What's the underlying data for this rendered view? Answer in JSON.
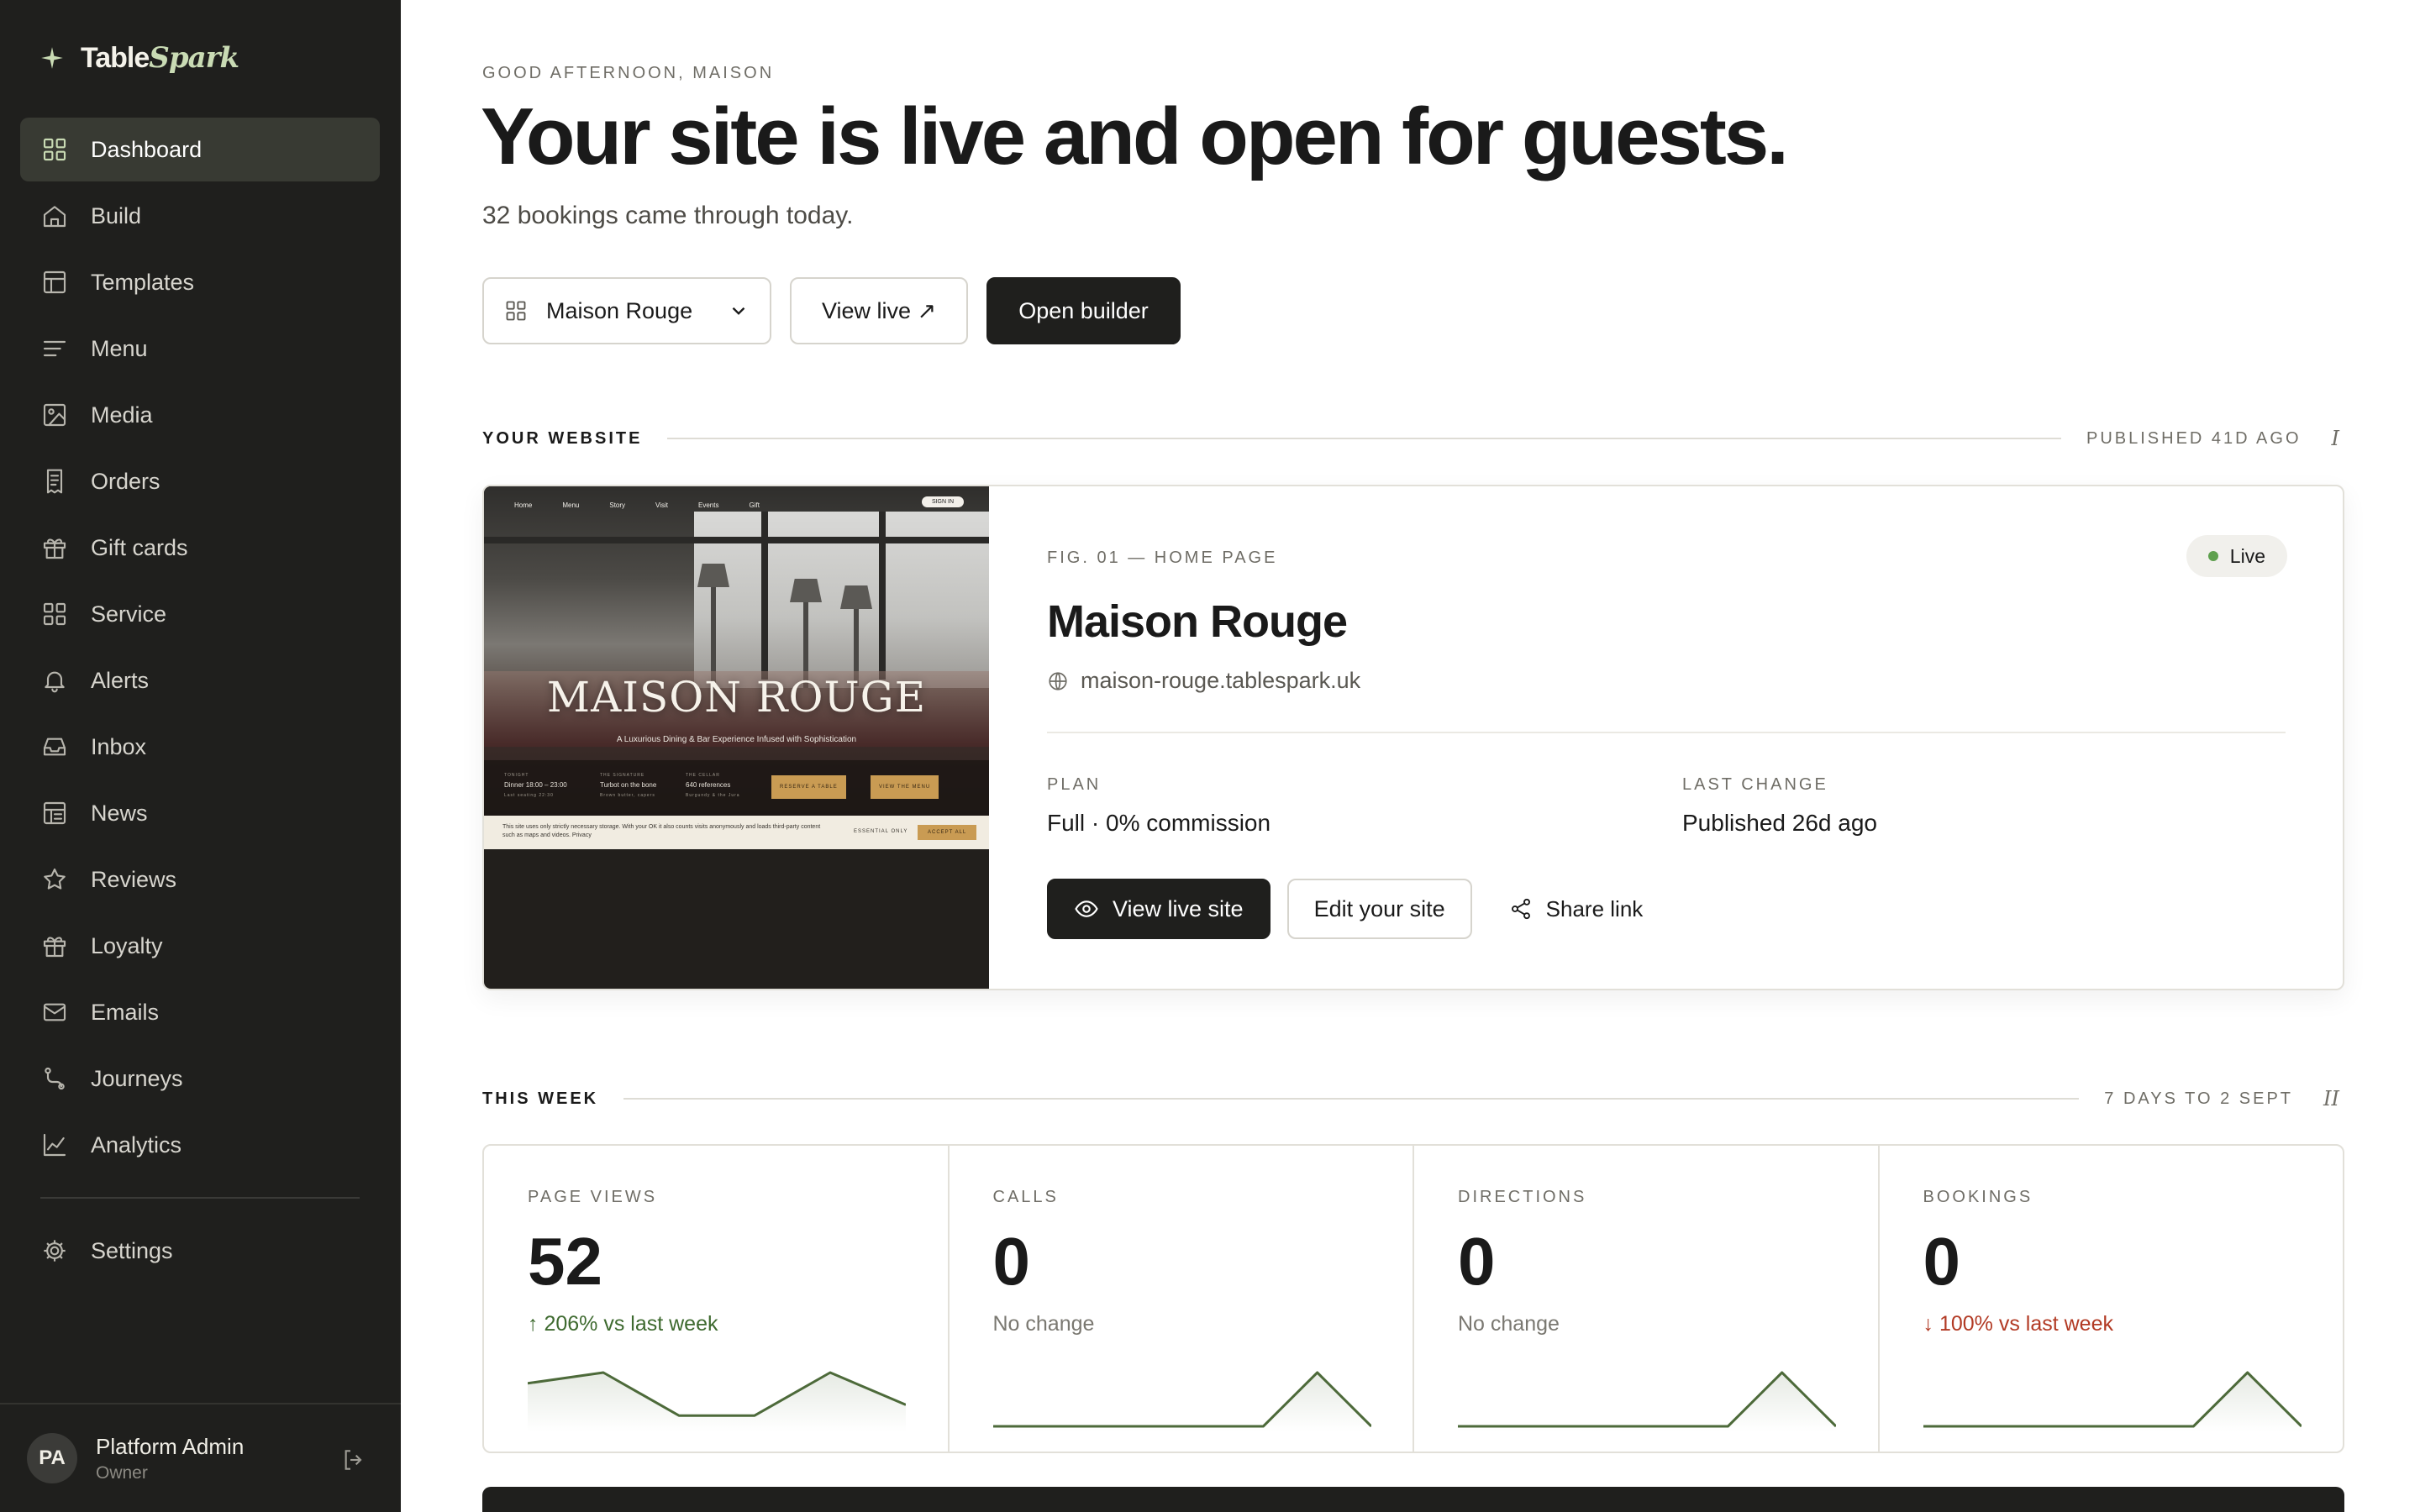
{
  "brand": {
    "name": "Table",
    "name_accent": "Spark"
  },
  "sidebar": {
    "items": [
      {
        "label": "Dashboard",
        "icon": "grid-icon",
        "active": true
      },
      {
        "label": "Build",
        "icon": "home-icon"
      },
      {
        "label": "Templates",
        "icon": "layout-icon"
      },
      {
        "label": "Menu",
        "icon": "lines-icon"
      },
      {
        "label": "Media",
        "icon": "image-icon"
      },
      {
        "label": "Orders",
        "icon": "receipt-icon"
      },
      {
        "label": "Gift cards",
        "icon": "gift-icon"
      },
      {
        "label": "Service",
        "icon": "grid-icon"
      },
      {
        "label": "Alerts",
        "icon": "bell-icon"
      },
      {
        "label": "Inbox",
        "icon": "inbox-icon"
      },
      {
        "label": "News",
        "icon": "newspaper-icon"
      },
      {
        "label": "Reviews",
        "icon": "star-icon"
      },
      {
        "label": "Loyalty",
        "icon": "gift-icon"
      },
      {
        "label": "Emails",
        "icon": "mail-icon"
      },
      {
        "label": "Journeys",
        "icon": "route-icon"
      },
      {
        "label": "Analytics",
        "icon": "chart-icon"
      }
    ],
    "settings_label": "Settings",
    "user": {
      "initials": "PA",
      "name": "Platform Admin",
      "role": "Owner"
    }
  },
  "header": {
    "greeting": "GOOD AFTERNOON, MAISON",
    "headline": "Your site is live and open for guests.",
    "subtitle": "32 bookings came through today.",
    "site_select": "Maison Rouge",
    "view_live": "View live ↗",
    "open_builder": "Open builder"
  },
  "website": {
    "section_title": "YOUR WEBSITE",
    "section_meta": "PUBLISHED 41D AGO",
    "section_num": "I",
    "fig_label": "FIG. 01 — HOME PAGE",
    "status": "Live",
    "name": "Maison Rouge",
    "url": "maison-rouge.tablespark.uk",
    "plan_label": "PLAN",
    "plan_value": "Full · 0% commission",
    "change_label": "LAST CHANGE",
    "change_value": "Published 26d ago",
    "view_site_btn": "View live site",
    "edit_btn": "Edit your site",
    "share_btn": "Share link",
    "preview": {
      "nav": [
        "Home",
        "Menu",
        "Story",
        "Visit",
        "Events",
        "Gift"
      ],
      "signin": "SIGN IN",
      "title": "MAISON ROUGE",
      "tagline": "A Luxurious Dining & Bar Experience Infused with Sophistication",
      "info": [
        {
          "k": "TONIGHT",
          "v": "Dinner 18:00 – 23:00",
          "s": "Last seating 22:30"
        },
        {
          "k": "THE SIGNATURE",
          "v": "Turbot on the bone",
          "s": "Brown butter, capers"
        },
        {
          "k": "THE CELLAR",
          "v": "640 references",
          "s": "Burgundy & the Jura"
        }
      ],
      "cta_primary": "RESERVE A TABLE",
      "cta_secondary": "VIEW THE MENU",
      "cookie_text": "This site uses only strictly necessary storage. With your OK it also counts visits anonymously and loads third-party content such as maps and videos. Privacy",
      "cookie_essential": "ESSENTIAL ONLY",
      "cookie_accept": "ACCEPT ALL"
    }
  },
  "week": {
    "section_title": "THIS WEEK",
    "section_meta": "7 DAYS TO 2 SEPT",
    "section_num": "II",
    "stats": [
      {
        "label": "PAGE VIEWS",
        "value": "52",
        "delta": "↑ 206% vs last week",
        "trend": "up",
        "spark": [
          4,
          5,
          1,
          1,
          5,
          2
        ]
      },
      {
        "label": "CALLS",
        "value": "0",
        "delta": "No change",
        "trend": "flat",
        "spark": [
          0,
          0,
          0,
          0,
          0,
          0,
          1,
          0
        ]
      },
      {
        "label": "DIRECTIONS",
        "value": "0",
        "delta": "No change",
        "trend": "flat",
        "spark": [
          0,
          0,
          0,
          0,
          0,
          0,
          1,
          0
        ]
      },
      {
        "label": "BOOKINGS",
        "value": "0",
        "delta": "↓ 100% vs last week",
        "trend": "down",
        "spark": [
          0,
          0,
          0,
          0,
          0,
          0,
          1,
          0
        ]
      }
    ]
  },
  "colors": {
    "sidebar_bg": "#1f1f1d",
    "accent_green": "#4d6a3a",
    "up": "#3e6a2f",
    "down": "#b23a24",
    "live": "#5fa04e"
  }
}
